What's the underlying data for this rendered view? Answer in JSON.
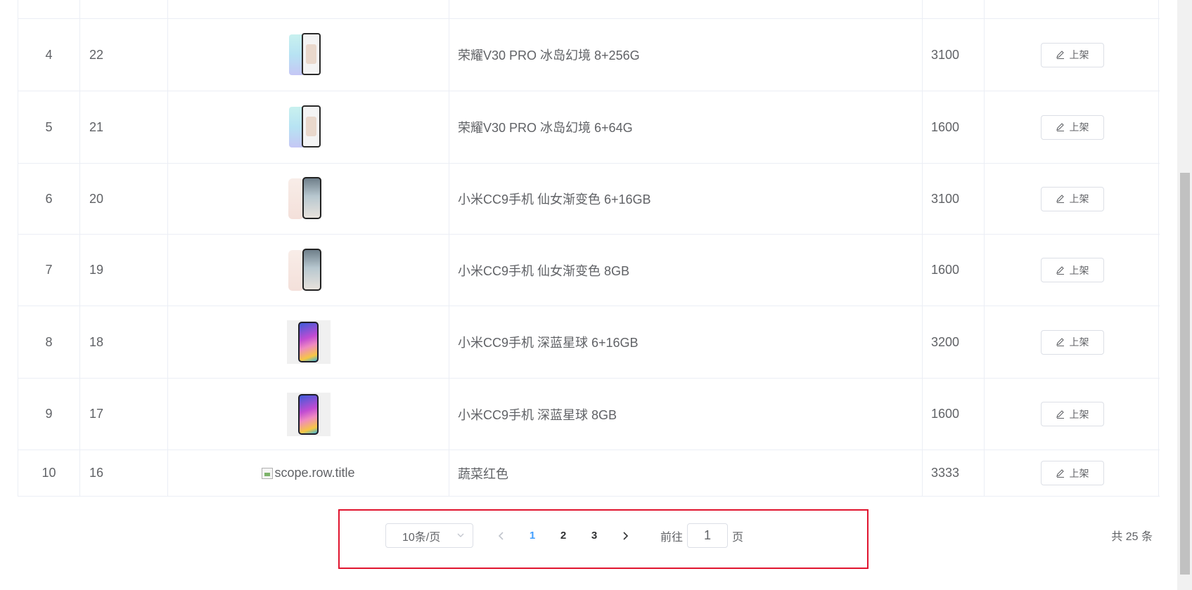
{
  "table": {
    "rows": [
      {
        "idx": "4",
        "id": "22",
        "image": "honor",
        "title": "荣耀V30 PRO 冰岛幻境 8+256G",
        "price": "3100",
        "action": "上架"
      },
      {
        "idx": "5",
        "id": "21",
        "image": "honor",
        "title": "荣耀V30 PRO 冰岛幻境 6+64G",
        "price": "1600",
        "action": "上架"
      },
      {
        "idx": "6",
        "id": "20",
        "image": "mi-white",
        "title": "小米CC9手机 仙女渐变色 6+16GB",
        "price": "3100",
        "action": "上架"
      },
      {
        "idx": "7",
        "id": "19",
        "image": "mi-white",
        "title": "小米CC9手机 仙女渐变色 8GB",
        "price": "1600",
        "action": "上架"
      },
      {
        "idx": "8",
        "id": "18",
        "image": "mi-blue",
        "title": "小米CC9手机 深蓝星球 6+16GB",
        "price": "3200",
        "action": "上架"
      },
      {
        "idx": "9",
        "id": "17",
        "image": "mi-blue",
        "title": "小米CC9手机 深蓝星球 8GB",
        "price": "1600",
        "action": "上架"
      },
      {
        "idx": "10",
        "id": "16",
        "image": "broken",
        "image_alt": "scope.row.title",
        "title": "蔬菜红色",
        "price": "3333",
        "action": "上架"
      }
    ]
  },
  "pagination": {
    "page_size": "10条/页",
    "pages": [
      "1",
      "2",
      "3"
    ],
    "current_page": "1",
    "goto_prefix": "前往",
    "goto_value": "1",
    "goto_suffix": "页",
    "total": "共 25 条"
  },
  "icons": {
    "edit": "edit-icon",
    "prev": "chevron-left-icon",
    "next": "chevron-right-icon",
    "select": "chevron-down-icon"
  },
  "colors": {
    "accent": "#409eff",
    "highlight_box": "#e0142e",
    "border": "#ebeef5",
    "text": "#606266"
  }
}
